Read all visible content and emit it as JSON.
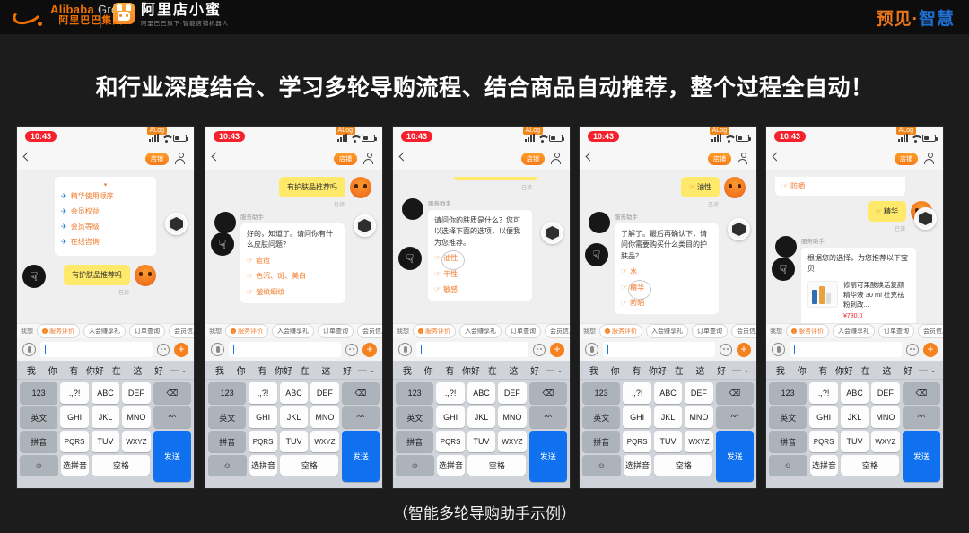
{
  "header": {
    "brand_left_en": "Alibaba",
    "brand_left_en_suffix": "Group",
    "brand_left_cn": "阿里巴巴集团",
    "brand_right_title": "阿里店小蜜",
    "brand_right_sub": "阿里巴巴旗下·智能店铺机器人",
    "brand_far_right_orange": "预见·",
    "brand_far_right_blue": "智慧"
  },
  "title": "和行业深度结合、学习多轮导购流程、结合商品自动推荐，整个过程全自动！",
  "caption": "（智能多轮导购助手示例）",
  "phone_chrome": {
    "time": "10:43",
    "alog_badge": "ALog",
    "nav_pill": "店铺",
    "bot_name": "服务助手",
    "read_mark": "已读",
    "quick_tabs_label": "我想",
    "quick_tabs": [
      "服务评价",
      "入会赚享礼",
      "订单查询",
      "会员信息"
    ]
  },
  "keyboard": {
    "predictions": [
      "我",
      "你",
      "有",
      "你好",
      "在",
      "这",
      "好"
    ],
    "separator": "—",
    "chevron": "⌄",
    "row1": [
      "123",
      ".,?!",
      "ABC",
      "DEF",
      "⌫"
    ],
    "row2": [
      "英文",
      "GHI",
      "JKL",
      "MNO",
      "^^"
    ],
    "row3": [
      "拼音",
      "PQRS",
      "TUV",
      "WXYZ",
      "发送"
    ],
    "row4": [
      "☺",
      "选拼音",
      "空格"
    ]
  },
  "phones": [
    {
      "id": "phone-1",
      "menu_items": [
        "精华使用顺序",
        "会员权益",
        "会员等级",
        "在线咨询"
      ],
      "user_message": "有护肤品推荐吗"
    },
    {
      "id": "phone-2",
      "user_message": "有护肤品推荐吗",
      "bot_message": "好的，知道了。请问你有什么皮肤问题？",
      "options": [
        "痘痘",
        "色沉、斑、美白",
        "皱纹细纹"
      ]
    },
    {
      "id": "phone-3",
      "bot_message": "请问你的肤质是什么？您可以选择下面的选项，以便我为您推荐。",
      "options": [
        "油性",
        "干性",
        "敏感"
      ],
      "circled_option": "油性"
    },
    {
      "id": "phone-4",
      "user_message": "油性",
      "bot_message": "了解了。最后再确认下，请问你需要购买什么类目的护肤品？",
      "options": [
        "水",
        "精华",
        "防晒"
      ],
      "circled_option": "精华"
    },
    {
      "id": "phone-5",
      "leftover_option": "防晒",
      "user_message": "精华",
      "bot_message": "根据您的选择，为您推荐以下宝贝",
      "product": {
        "title": "修丽可果酸焕活复颜精华液 30 ml 杜克祛粉刺改...",
        "price": "¥780.0"
      }
    }
  ],
  "icons": {
    "pointer": "☞",
    "plane": "✈",
    "hand": "☟"
  },
  "colors": {
    "accent_orange": "#f07b2c",
    "brand_blue": "#1f6fd0",
    "bubble_yellow": "#ffe96b",
    "send_blue": "#1071f0"
  }
}
